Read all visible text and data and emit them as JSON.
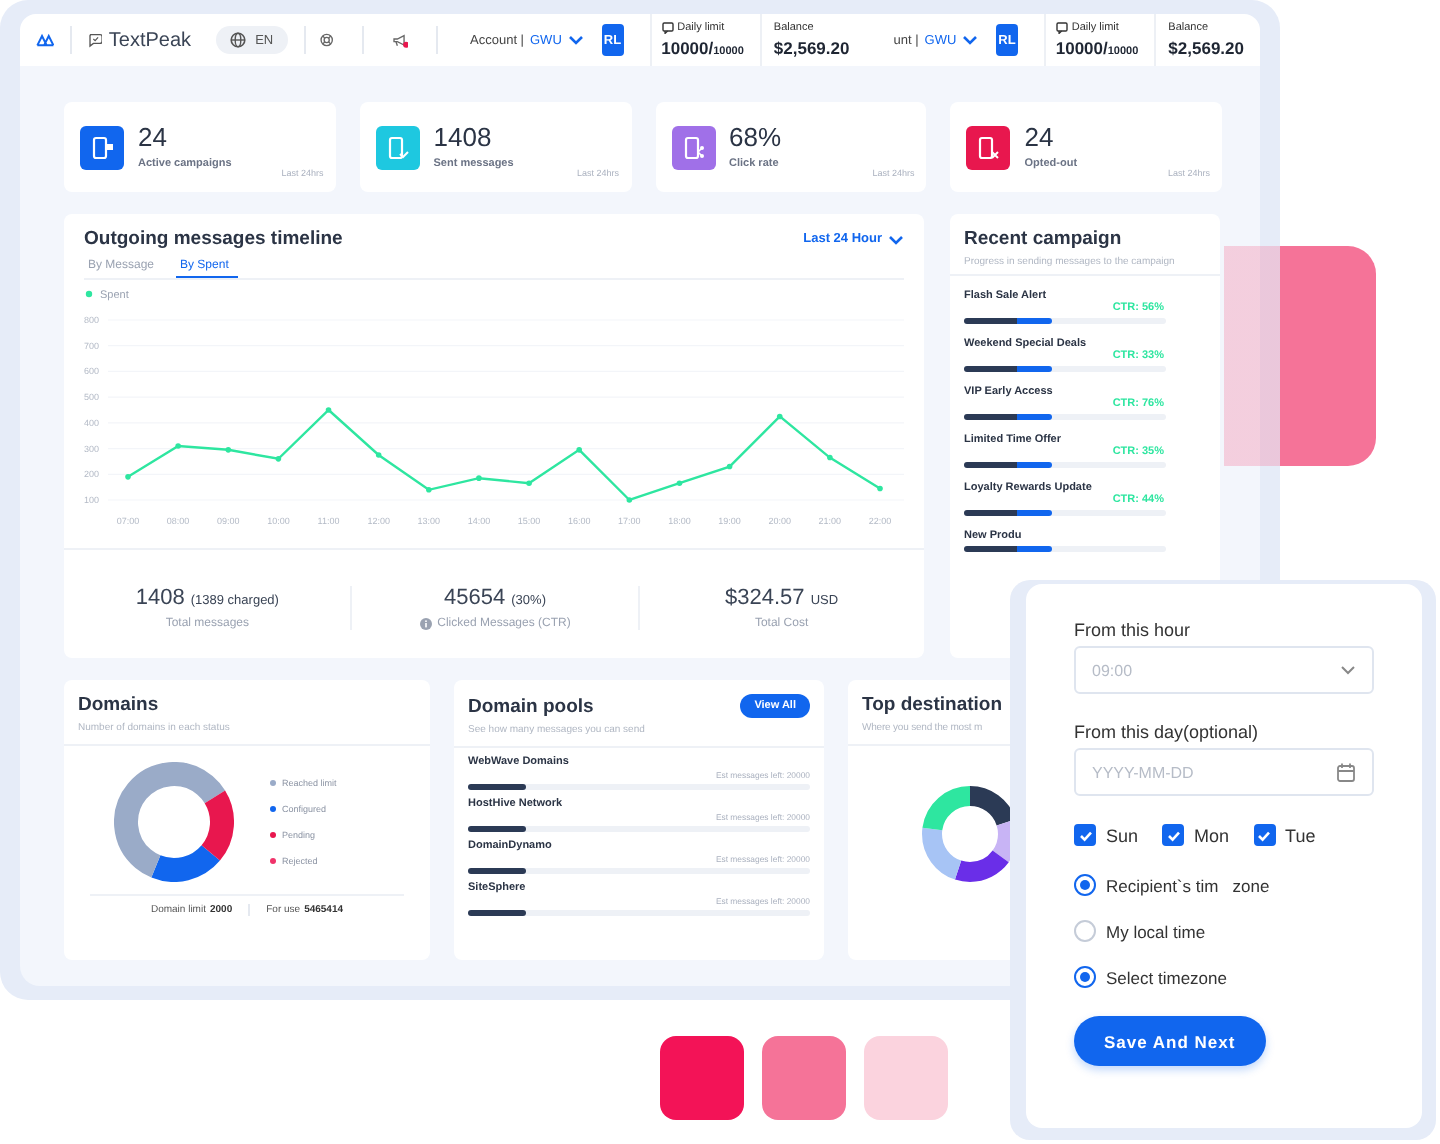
{
  "topbar": {
    "brand": "TextPeak",
    "language": "EN",
    "sections": [
      {
        "account": "Account |",
        "unit": "GWU",
        "avatar": "RL",
        "limit_label": "Daily limit",
        "limit_value": "10000/",
        "limit_max": "10000",
        "balance_label": "Balance",
        "balance": "$2,569.20"
      },
      {
        "account": "unt |",
        "unit": "GWU",
        "avatar": "RL",
        "limit_label": "Daily limit",
        "limit_value": "10000/",
        "limit_max": "10000",
        "balance_label": "Balance",
        "balance": "$2,569.20"
      }
    ]
  },
  "stats": [
    {
      "value": "24",
      "label": "Active campaigns",
      "period": "Last 24hrs",
      "color": "#1166ee"
    },
    {
      "value": "1408",
      "label": "Sent messages",
      "period": "Last 24hrs",
      "color": "#1ec8e0"
    },
    {
      "value": "68%",
      "label": "Click rate",
      "period": "Last 24hrs",
      "color": "#a070e8"
    },
    {
      "value": "24",
      "label": "Opted-out",
      "period": "Last 24hrs",
      "color": "#e8174e"
    }
  ],
  "timeline": {
    "title": "Outgoing messages timeline",
    "range": "Last 24 Hour",
    "tabs": [
      {
        "label": "By Message",
        "selected": false
      },
      {
        "label": "By Spent",
        "selected": true
      }
    ],
    "chart_data": {
      "type": "line",
      "categories": [
        "07:00",
        "08:00",
        "09:00",
        "10:00",
        "11:00",
        "12:00",
        "13:00",
        "14:00",
        "15:00",
        "16:00",
        "17:00",
        "18:00",
        "19:00",
        "20:00",
        "21:00",
        "22:00"
      ],
      "series": [
        {
          "name": "Spent",
          "color": "#2ee6a0",
          "values": [
            190,
            310,
            295,
            260,
            450,
            275,
            140,
            185,
            165,
            295,
            100,
            165,
            230,
            425,
            265,
            145
          ]
        }
      ],
      "grid": true,
      "ylim": [
        100,
        800
      ],
      "yticks": [
        100,
        200,
        300,
        400,
        500,
        600,
        700,
        800
      ]
    },
    "totals": [
      {
        "value": "1408",
        "note": "(1389 charged)",
        "label": "Total messages",
        "info": false
      },
      {
        "value": "45654",
        "note": "(30%)",
        "label": "Clicked Messages (CTR)",
        "info": true
      },
      {
        "value": "$324.57",
        "note": "USD",
        "label": "Total Cost",
        "info": false
      }
    ]
  },
  "recent": {
    "title": "Recent campaign",
    "subtitle": "Progress in sending messages to the campaign",
    "items": [
      {
        "name": "Flash Sale Alert",
        "ctr": "CTR: 56%",
        "level": 0.44
      },
      {
        "name": "Weekend Special Deals",
        "ctr": "CTR: 33%",
        "level": 0.44
      },
      {
        "name": "VIP Early Access",
        "ctr": "CTR: 76%",
        "level": 0.44
      },
      {
        "name": "Limited Time Offer",
        "ctr": "CTR: 35%",
        "level": 0.44
      },
      {
        "name": "Loyalty Rewards Update",
        "ctr": "CTR: 44%",
        "level": 0.44
      },
      {
        "name": "New Produ",
        "level": 0.44
      }
    ]
  },
  "domains": {
    "title": "Domains",
    "subtitle": "Number of domains in each status",
    "legend": [
      {
        "label": "Reached limit",
        "color": "#9aabc8"
      },
      {
        "label": "Configured",
        "color": "#1166ee"
      },
      {
        "label": "Pending",
        "color": "#e8174e"
      },
      {
        "label": "Rejected",
        "color": "#f0336a"
      }
    ],
    "limit_label": "Domain limit",
    "limit": "2000",
    "use_label": "For use",
    "use": "5465414"
  },
  "pools": {
    "title": "Domain pools",
    "button": "View All",
    "subtitle": "See how many messages you can send",
    "items": [
      {
        "name": "WebWave Domains",
        "est_label": "Est messages left:",
        "est": "20000",
        "level": 0.17
      },
      {
        "name": "HostHive Network",
        "est_label": "Est messages left:",
        "est": "20000",
        "level": 0.17
      },
      {
        "name": "DomainDynamo",
        "est_label": "Est messages left:",
        "est": "20000",
        "level": 0.17
      },
      {
        "name": "SiteSphere",
        "est_label": "Est messages left:",
        "est": "20000",
        "level": 0.17
      }
    ]
  },
  "destination": {
    "title": "Top destination",
    "subtitle": "Where you send the most m"
  },
  "popup": {
    "hour": {
      "label": "From this hour",
      "placeholder": "09:00"
    },
    "day": {
      "label": "From this day(optional)",
      "placeholder": "YYYY-MM-DD"
    },
    "days": [
      {
        "label": "Sun",
        "checked": true
      },
      {
        "label": "Mon",
        "checked": true
      },
      {
        "label": "Tue",
        "checked": true
      }
    ],
    "timezones": [
      {
        "label": "Recipient`s tim   zone",
        "selected": true
      },
      {
        "label": "My local time",
        "selected": false
      },
      {
        "label": "Select timezone",
        "selected": true
      }
    ],
    "button": "Save And Next"
  }
}
